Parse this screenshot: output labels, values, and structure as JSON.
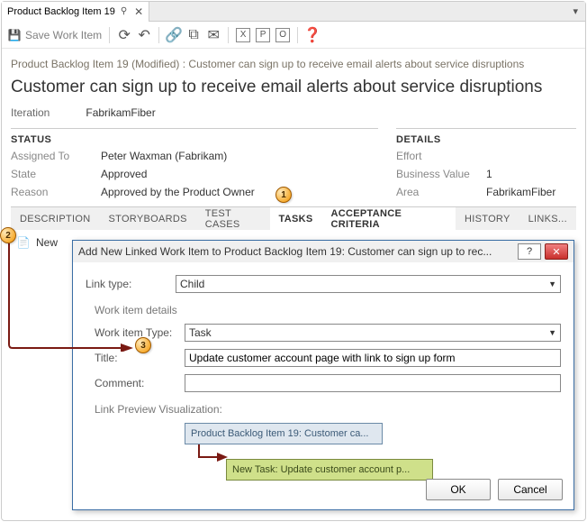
{
  "tabstrip": {
    "doc_title": "Product Backlog Item 19"
  },
  "toolbar": {
    "save_label": "Save Work Item",
    "boxed": [
      "X",
      "P",
      "O"
    ]
  },
  "modified_line": "Product Backlog Item 19 (Modified) : Customer can sign up to receive email alerts about service disruptions",
  "work_item": {
    "title": "Customer can sign up to receive email alerts about service disruptions",
    "iteration_label": "Iteration",
    "iteration_value": "FabrikamFiber"
  },
  "status": {
    "header": "STATUS",
    "assigned_label": "Assigned To",
    "assigned_value": "Peter Waxman (Fabrikam)",
    "state_label": "State",
    "state_value": "Approved",
    "reason_label": "Reason",
    "reason_value": "Approved by the Product Owner"
  },
  "details": {
    "header": "DETAILS",
    "effort_label": "Effort",
    "effort_value": "",
    "bv_label": "Business Value",
    "bv_value": "1",
    "area_label": "Area",
    "area_value": "FabrikamFiber"
  },
  "tabs": {
    "description": "DESCRIPTION",
    "storyboards": "STORYBOARDS",
    "testcases": "TEST CASES",
    "tasks": "TASKS",
    "acceptance": "ACCEPTANCE CRITERIA",
    "history": "HISTORY",
    "links": "LINKS..."
  },
  "newlink": {
    "label": "New"
  },
  "callouts": {
    "c1": "1",
    "c2": "2",
    "c3": "3"
  },
  "dialog": {
    "title": "Add New Linked Work Item to Product Backlog Item 19: Customer can sign up to rec...",
    "link_type_label": "Link type:",
    "link_type_value": "Child",
    "group_label": "Work item details",
    "wit_label": "Work item Type:",
    "wit_value": "Task",
    "title_label": "Title:",
    "title_value": "Update customer account page with link to sign up form",
    "comment_label": "Comment:",
    "comment_value": "",
    "preview_label": "Link Preview Visualization:",
    "preview_box1": "Product Backlog Item 19: Customer ca...",
    "preview_box2": "New Task: Update customer account p...",
    "ok": "OK",
    "cancel": "Cancel"
  }
}
